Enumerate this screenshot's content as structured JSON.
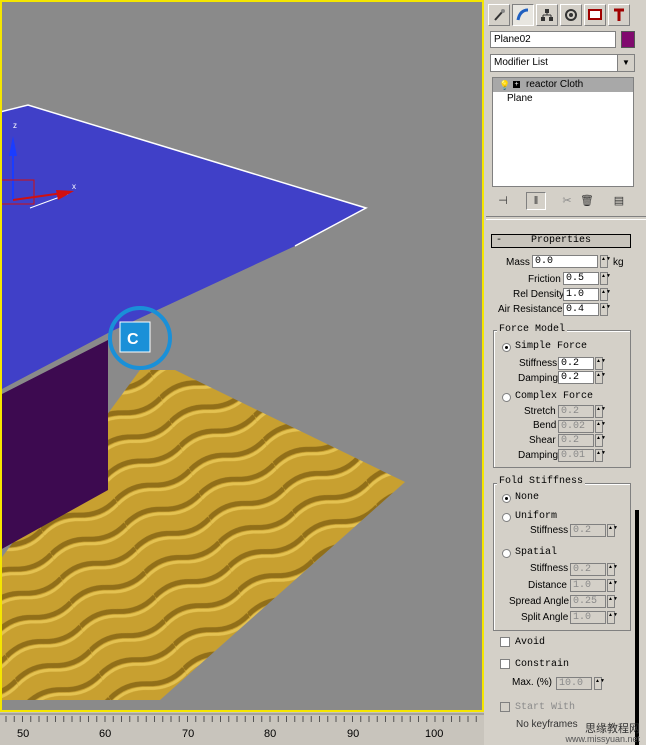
{
  "object_name": "Plane02",
  "colors": {
    "object_swatch": "#800a6e",
    "plane": "#4040c8",
    "box": "#3d0a50",
    "floor": "#c8a030",
    "viewport_border": "#f5e600",
    "reactor_icon": "#1a90d8"
  },
  "viewport": {
    "reactor_icon_label": "C",
    "gizmo_axis_label": "x"
  },
  "command_tabs": [
    {
      "icon": "create-icon"
    },
    {
      "icon": "modify-icon"
    },
    {
      "icon": "hierarchy-icon"
    },
    {
      "icon": "motion-icon"
    },
    {
      "icon": "display-icon"
    },
    {
      "icon": "utilities-icon"
    }
  ],
  "modifier_list": {
    "label": "Modifier List"
  },
  "modifier_stack": [
    {
      "label": "reactor Cloth",
      "selected": true
    },
    {
      "label": "Plane",
      "selected": false
    }
  ],
  "properties": {
    "title": "Properties",
    "mass": {
      "label": "Mass",
      "value": "0.0",
      "unit": "kg"
    },
    "friction": {
      "label": "Friction",
      "value": "0.5"
    },
    "rel_density": {
      "label": "Rel Density",
      "value": "1.0"
    },
    "air_resistance": {
      "label": "Air Resistance",
      "value": "0.4"
    }
  },
  "force_model": {
    "title": "Force Model",
    "simple": {
      "label": "Simple Force",
      "selected": true,
      "stiffness_label": "Stiffness",
      "stiffness": "0.2",
      "damping_label": "Damping",
      "damping": "0.2"
    },
    "complex": {
      "label": "Complex Force",
      "selected": false,
      "stretch_label": "Stretch",
      "stretch": "0.2",
      "bend_label": "Bend",
      "bend": "0.02",
      "shear_label": "Shear",
      "shear": "0.2",
      "damping_label": "Damping",
      "damping": "0.01"
    }
  },
  "fold_stiffness": {
    "title": "Fold Stiffness",
    "none": {
      "label": "None",
      "selected": true
    },
    "uniform": {
      "label": "Uniform",
      "stiffness_label": "Stiffness",
      "stiffness": "0.2"
    },
    "spatial": {
      "label": "Spatial",
      "stiffness_label": "Stiffness",
      "stiffness": "0.2",
      "distance_label": "Distance",
      "distance": "1.0",
      "spread_label": "Spread Angle",
      "spread": "0.25",
      "split_label": "Split Angle",
      "split": "1.0"
    }
  },
  "avoid": {
    "label": "Avoid"
  },
  "constrain": {
    "label": "Constrain",
    "max_label": "Max. (%)",
    "max_value": "10.0"
  },
  "start_with": {
    "label": "Start With",
    "note": "No keyframes"
  },
  "timeline": {
    "ticks": [
      "50",
      "60",
      "70",
      "80",
      "90",
      "100"
    ]
  },
  "watermark": {
    "line1": "思缘教程网",
    "line2": "www.missyuan.net"
  }
}
